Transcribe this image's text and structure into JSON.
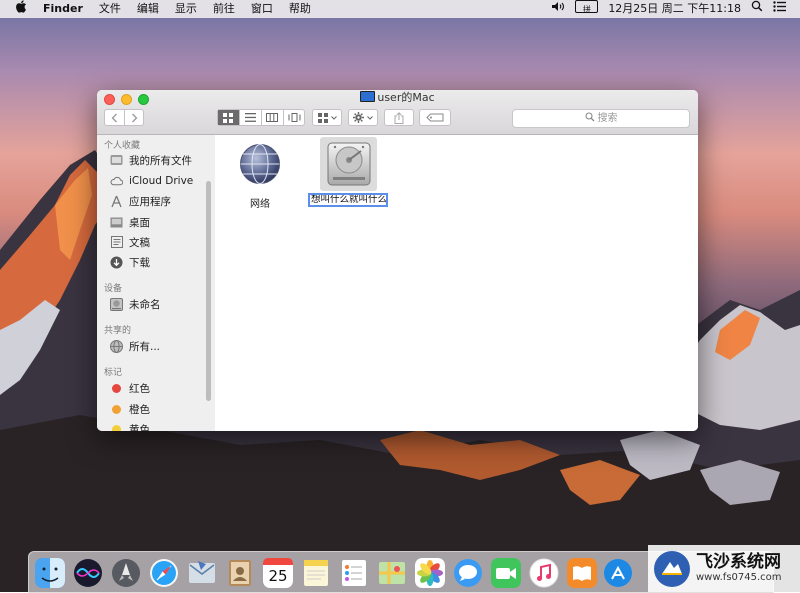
{
  "menubar": {
    "apple": "",
    "app_name": "Finder",
    "menus": [
      "文件",
      "编辑",
      "显示",
      "前往",
      "窗口",
      "帮助"
    ],
    "ime_glyph": "拼",
    "clock": "12月25日 周二 下午11:18",
    "icons": [
      "volume-icon",
      "input-method-icon",
      "spotlight-icon",
      "notification-center-icon"
    ]
  },
  "window": {
    "title": "user的Mac",
    "search_placeholder": "搜索",
    "view_mode": "icon"
  },
  "sidebar": {
    "sections": [
      {
        "title": "个人收藏",
        "items": [
          {
            "label": "我的所有文件",
            "icon": "all-files-icon"
          },
          {
            "label": "iCloud Drive",
            "icon": "cloud-icon"
          },
          {
            "label": "应用程序",
            "icon": "applications-icon"
          },
          {
            "label": "桌面",
            "icon": "desktop-icon"
          },
          {
            "label": "文稿",
            "icon": "documents-icon"
          },
          {
            "label": "下载",
            "icon": "downloads-icon"
          }
        ]
      },
      {
        "title": "设备",
        "items": [
          {
            "label": "未命名",
            "icon": "drive-icon"
          }
        ]
      },
      {
        "title": "共享的",
        "items": [
          {
            "label": "所有...",
            "icon": "network-globe-icon"
          }
        ]
      },
      {
        "title": "标记",
        "items": [
          {
            "label": "红色",
            "color": "#e5463e"
          },
          {
            "label": "橙色",
            "color": "#f1a235"
          },
          {
            "label": "黄色",
            "color": "#f2cf3a"
          }
        ]
      }
    ]
  },
  "content": {
    "items": [
      {
        "label": "网络",
        "icon": "network-globe-icon"
      },
      {
        "label": "想叫什么就叫什么",
        "icon": "hard-drive-icon",
        "renaming": true
      }
    ]
  },
  "dock": {
    "apps": [
      "finder-icon",
      "siri-icon",
      "launchpad-icon",
      "safari-icon",
      "mail-icon",
      "contacts-icon",
      "calendar-icon",
      "notes-icon",
      "reminders-icon",
      "maps-icon",
      "photos-icon",
      "messages-icon",
      "facetime-icon",
      "itunes-icon",
      "ibooks-icon",
      "app-store-icon"
    ],
    "calendar_day": "25"
  },
  "watermark": {
    "title": "飞沙系统网",
    "url": "www.fs0745.com"
  },
  "colors": {
    "close": "#fc5f57",
    "minimize": "#fdbc2e",
    "zoom": "#28c840",
    "selection_ring": "#5b8fe8"
  }
}
